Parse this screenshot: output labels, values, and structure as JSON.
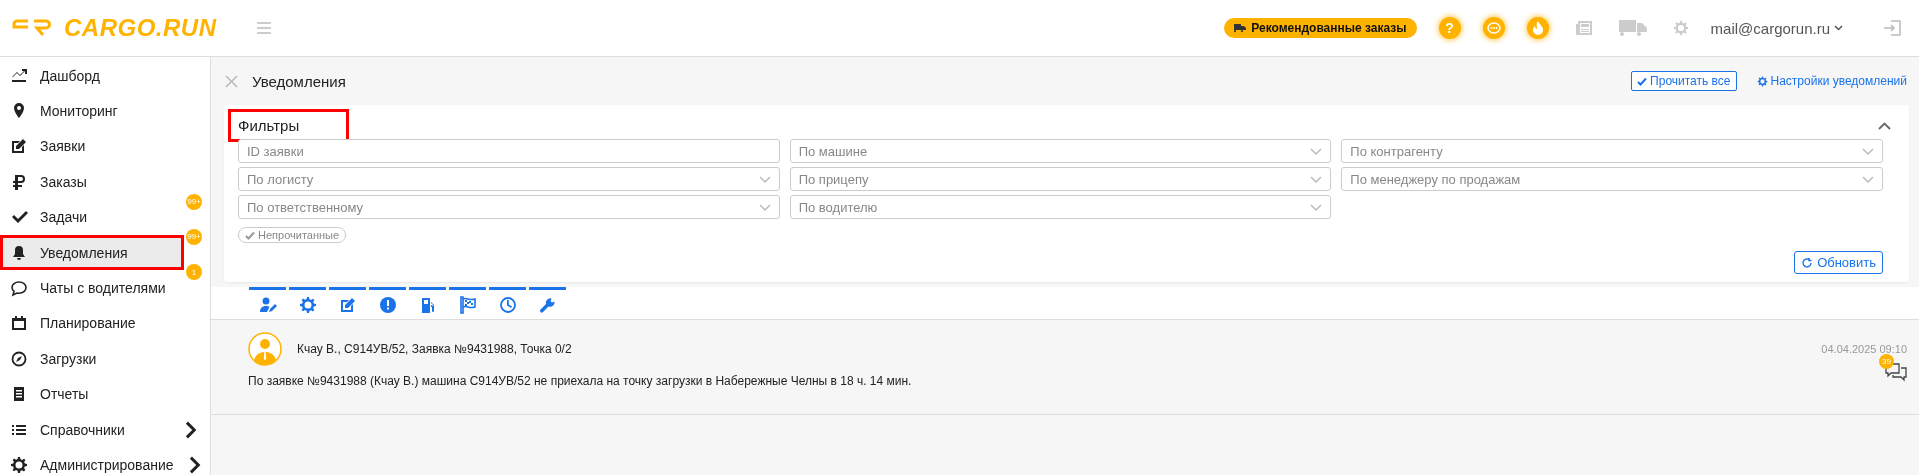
{
  "header": {
    "logo": "CARGO.RUN",
    "recommended_button": "Рекомендованные заказы",
    "help_icon": "?",
    "user_email": "mail@cargorun.ru"
  },
  "sidebar": {
    "items": [
      {
        "label": "Дашборд",
        "selected": false,
        "highlighted": false
      },
      {
        "label": "Мониторинг",
        "selected": false,
        "highlighted": false
      },
      {
        "label": "Заявки",
        "selected": false,
        "highlighted": false
      },
      {
        "label": "Заказы",
        "selected": false,
        "highlighted": false
      },
      {
        "label": "Задачи",
        "selected": false,
        "highlighted": false,
        "badge": "99+"
      },
      {
        "label": "Уведомления",
        "selected": true,
        "highlighted": true,
        "badge": "99+"
      },
      {
        "label": "Чаты с водителями",
        "selected": false,
        "highlighted": false,
        "badge": "1"
      },
      {
        "label": "Планирование",
        "selected": false,
        "highlighted": false
      },
      {
        "label": "Загрузки",
        "selected": false,
        "highlighted": false
      },
      {
        "label": "Отчеты",
        "selected": false,
        "highlighted": false
      },
      {
        "label": "Справочники",
        "selected": false,
        "highlighted": false,
        "expandable": true
      },
      {
        "label": "Администрирование",
        "selected": false,
        "highlighted": false,
        "expandable": true
      }
    ]
  },
  "page": {
    "title": "Уведомления",
    "read_all_button": "Прочитать все",
    "settings_link": "Настройки уведомлений"
  },
  "filters": {
    "title": "Фильтры",
    "title_highlighted": true,
    "expanded": true,
    "fields": [
      {
        "placeholder": "ID заявки",
        "kind": "input"
      },
      {
        "placeholder": "По машине",
        "kind": "select"
      },
      {
        "placeholder": "По контрагенту",
        "kind": "select"
      },
      {
        "placeholder": "По логисту",
        "kind": "select"
      },
      {
        "placeholder": "По прицепу",
        "kind": "select"
      },
      {
        "placeholder": "По менеджеру по продажам",
        "kind": "select"
      },
      {
        "placeholder": "По ответственному",
        "kind": "select"
      },
      {
        "placeholder": "По водителю",
        "kind": "select"
      }
    ],
    "unread_chip": "Непрочитанные",
    "refresh_button": "Обновить"
  },
  "category_tabs": [
    {
      "selected": true
    },
    {
      "selected": true
    },
    {
      "selected": true
    },
    {
      "selected": true
    },
    {
      "selected": true
    },
    {
      "selected": true
    },
    {
      "selected": true
    },
    {
      "selected": true
    }
  ],
  "notifications": [
    {
      "subject": "Кчау В., С914УВ/52, Заявка №9431988, Точка 0/2",
      "time": "04.04.2025 09:10",
      "message": "По заявке №9431988 (Кчау В.) машина С914УВ/52 не приехала на точку загрузки в Набережные Челны в 18 ч. 14 мин.",
      "comments_count": "39"
    }
  ]
}
